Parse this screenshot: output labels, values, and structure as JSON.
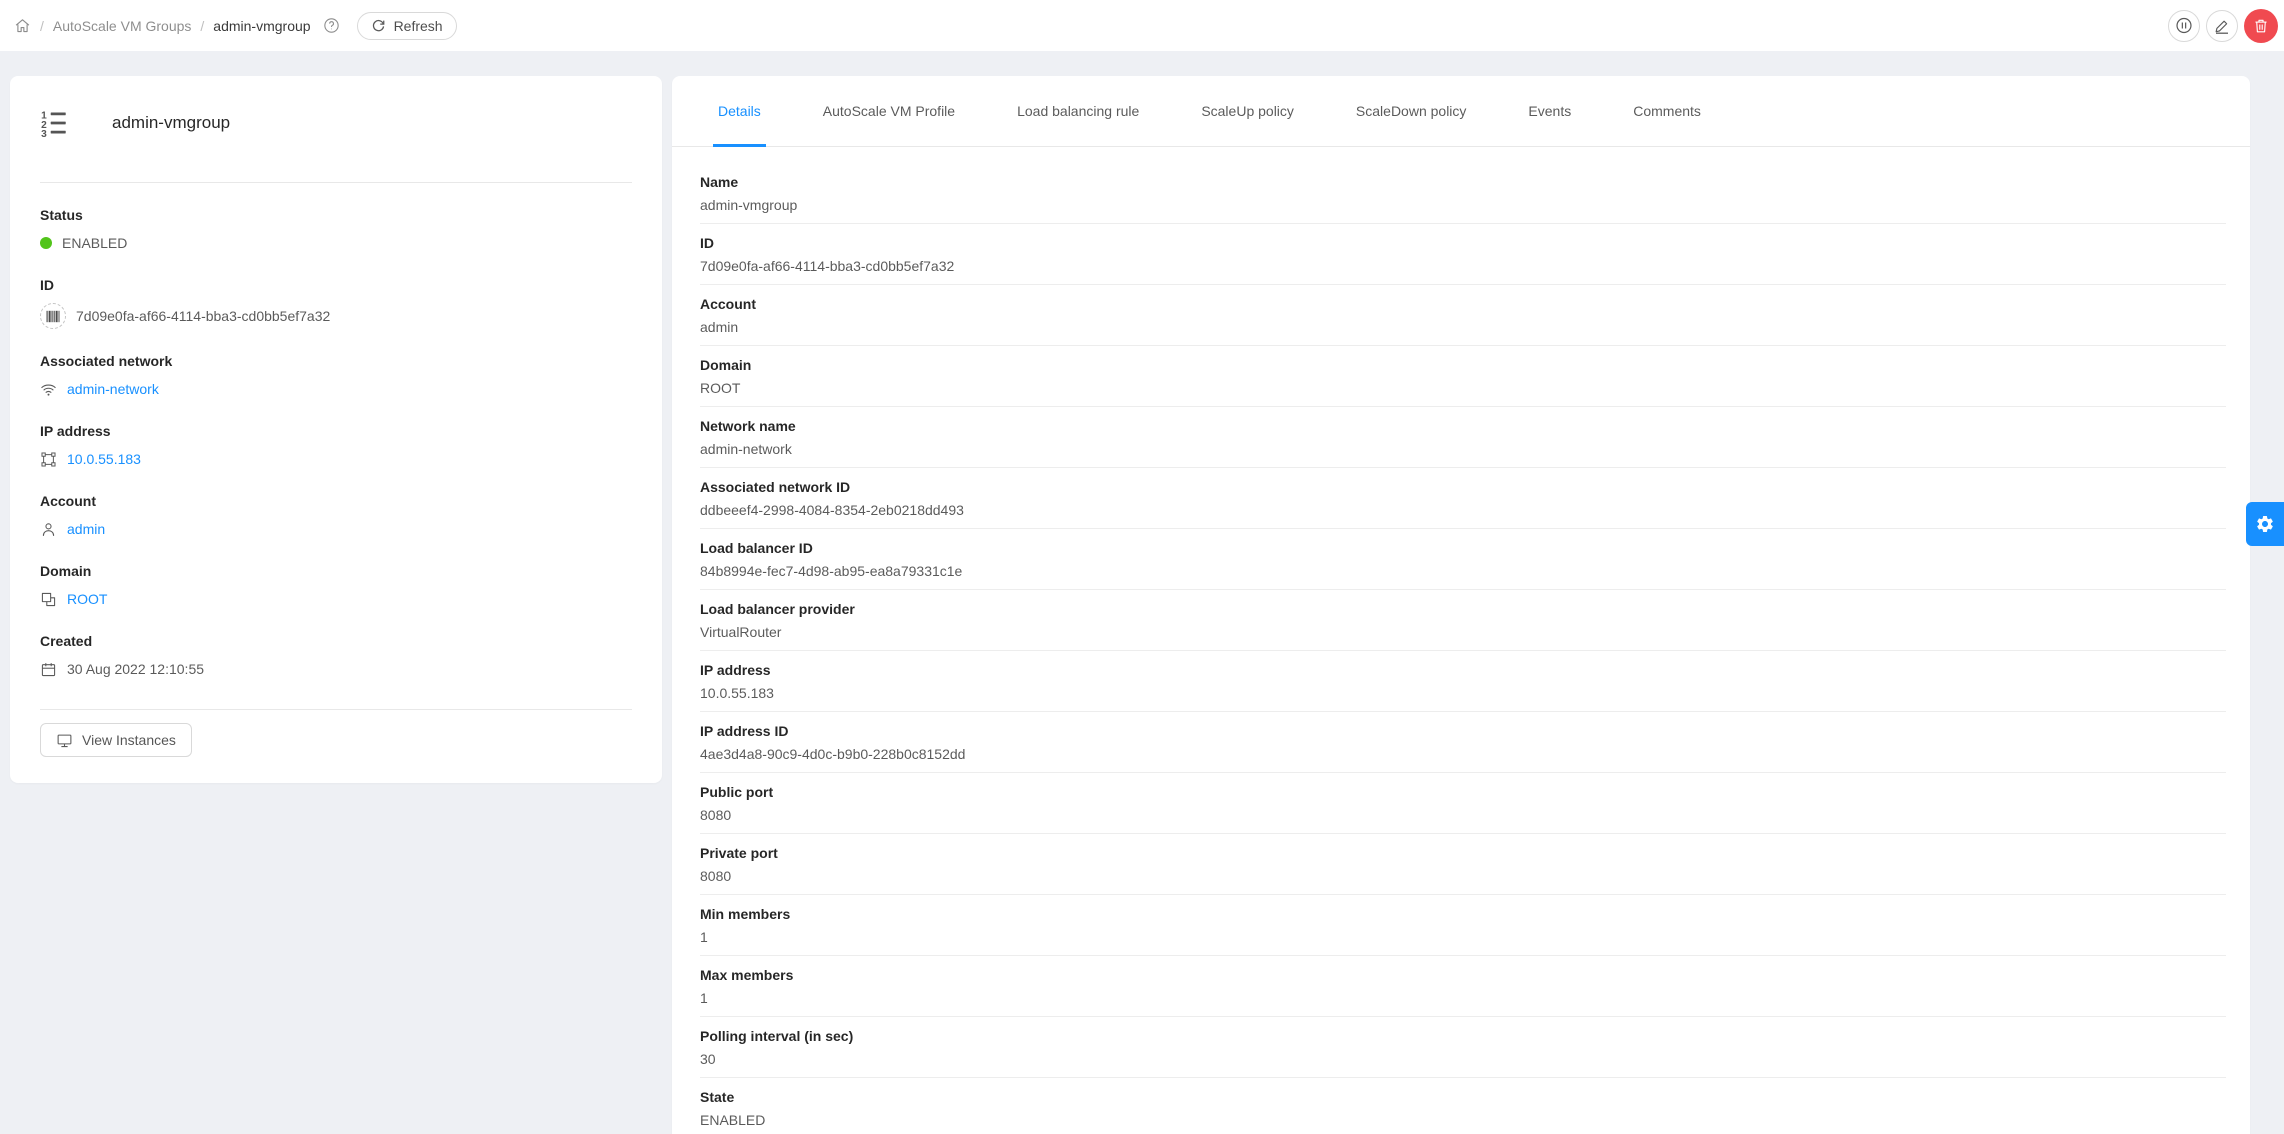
{
  "topbar": {
    "breadcrumb": {
      "root": "AutoScale VM Groups",
      "current": "admin-vmgroup"
    },
    "refresh_label": "Refresh"
  },
  "info_card": {
    "title": "admin-vmgroup",
    "fields": {
      "status": {
        "label": "Status",
        "value": "ENABLED"
      },
      "id": {
        "label": "ID",
        "value": "7d09e0fa-af66-4114-bba3-cd0bb5ef7a32"
      },
      "network": {
        "label": "Associated network",
        "value": "admin-network"
      },
      "ip": {
        "label": "IP address",
        "value": "10.0.55.183"
      },
      "account": {
        "label": "Account",
        "value": "admin"
      },
      "domain": {
        "label": "Domain",
        "value": "ROOT"
      },
      "created": {
        "label": "Created",
        "value": "30 Aug 2022 12:10:55"
      }
    },
    "view_instances_label": "View Instances"
  },
  "tabs": {
    "active": "Details",
    "items": [
      "Details",
      "AutoScale VM Profile",
      "Load balancing rule",
      "ScaleUp policy",
      "ScaleDown policy",
      "Events",
      "Comments"
    ]
  },
  "details": {
    "rows": [
      {
        "label": "Name",
        "value": "admin-vmgroup"
      },
      {
        "label": "ID",
        "value": "7d09e0fa-af66-4114-bba3-cd0bb5ef7a32"
      },
      {
        "label": "Account",
        "value": "admin"
      },
      {
        "label": "Domain",
        "value": "ROOT"
      },
      {
        "label": "Network name",
        "value": "admin-network"
      },
      {
        "label": "Associated network ID",
        "value": "ddbeeef4-2998-4084-8354-2eb0218dd493"
      },
      {
        "label": "Load balancer ID",
        "value": "84b8994e-fec7-4d98-ab95-ea8a79331c1e"
      },
      {
        "label": "Load balancer provider",
        "value": "VirtualRouter"
      },
      {
        "label": "IP address",
        "value": "10.0.55.183"
      },
      {
        "label": "IP address ID",
        "value": "4ae3d4a8-90c9-4d0c-b9b0-228b0c8152dd"
      },
      {
        "label": "Public port",
        "value": "8080"
      },
      {
        "label": "Private port",
        "value": "8080"
      },
      {
        "label": "Min members",
        "value": "1"
      },
      {
        "label": "Max members",
        "value": "1"
      },
      {
        "label": "Polling interval (in sec)",
        "value": "30"
      },
      {
        "label": "State",
        "value": "ENABLED"
      }
    ]
  },
  "colors": {
    "accent": "#1890ff",
    "link": "#1890ff",
    "status_enabled": "#52c41a",
    "danger": "#f04a50"
  }
}
